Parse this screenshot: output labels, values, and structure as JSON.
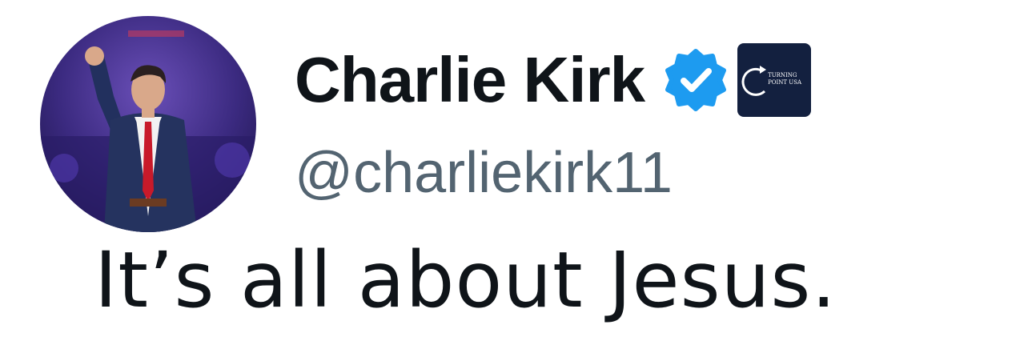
{
  "author": {
    "display_name": "Charlie Kirk",
    "handle": "@charliekirk11",
    "verified_badge_icon": "verified-badge-icon",
    "verified_color": "#1d9bf0",
    "affiliate_badge": {
      "icon": "turning-point-usa-logo",
      "lines": [
        "TURNING",
        "POINT USA"
      ],
      "background": "#13203f"
    },
    "avatar_icon": "profile-photo"
  },
  "tweet": {
    "text": "It’s all about Jesus."
  },
  "colors": {
    "text_primary": "#0f1419",
    "text_secondary": "#536471"
  }
}
